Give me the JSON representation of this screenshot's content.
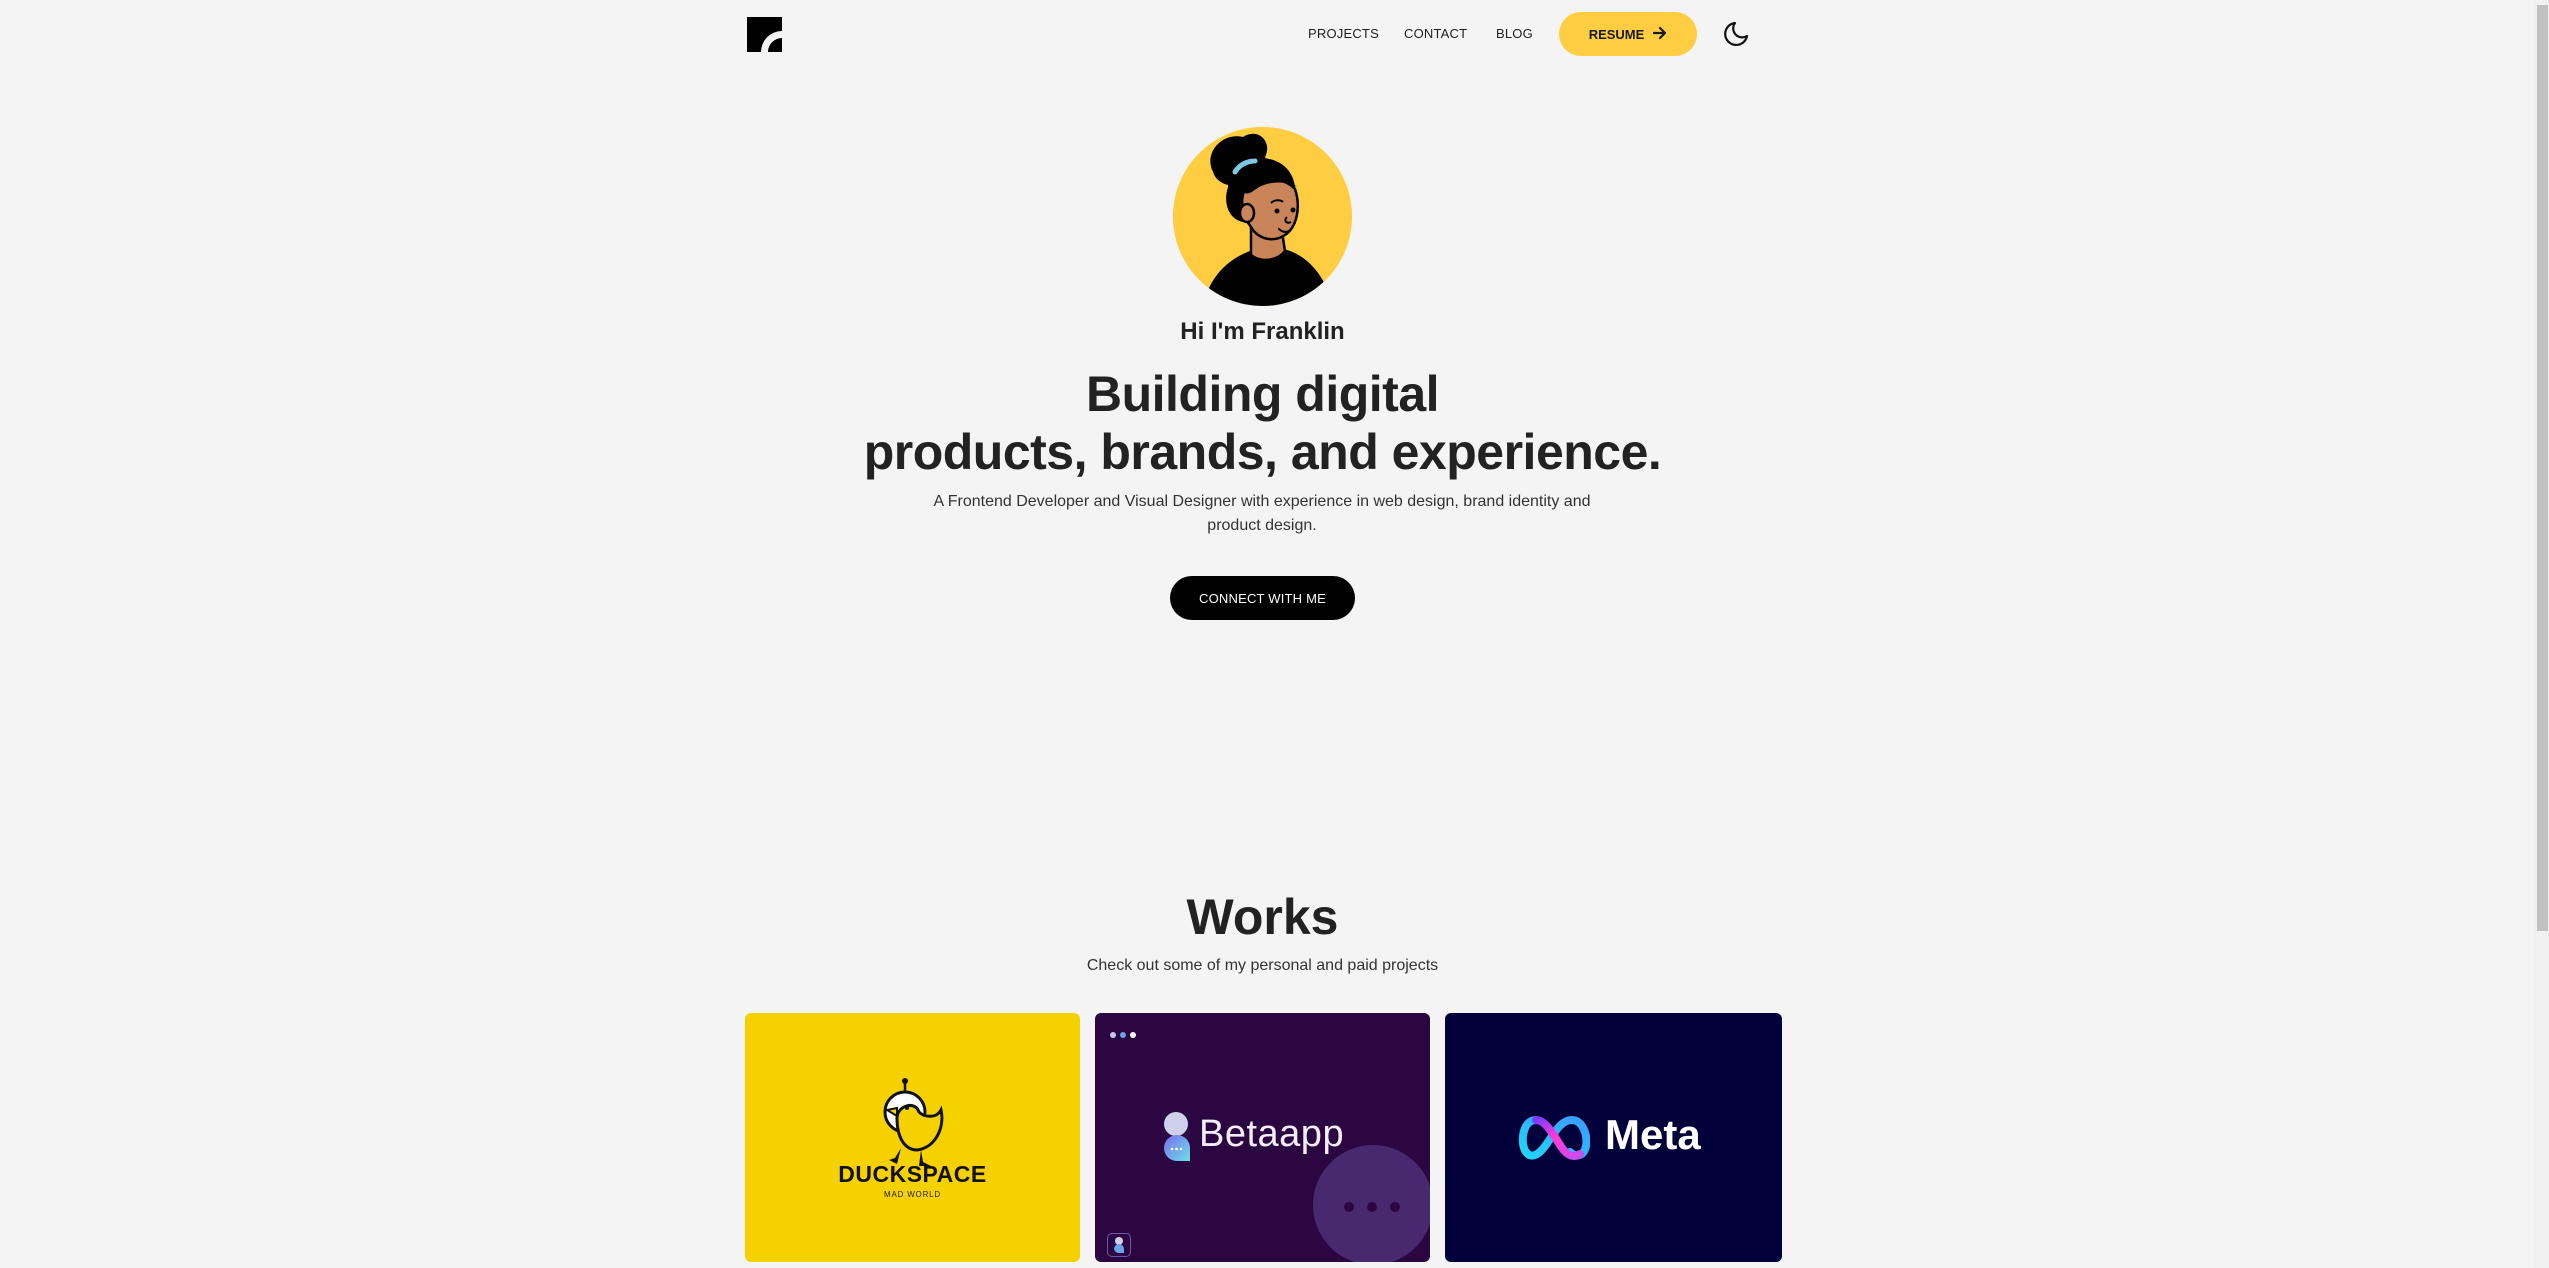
{
  "header": {
    "logo_icon": "brand-logo-icon",
    "nav": [
      {
        "label": "PROJECTS"
      },
      {
        "label": "CONTACT"
      },
      {
        "label": "BLOG"
      }
    ],
    "resume_label": "RESUME",
    "resume_icon": "arrow-right-icon",
    "theme_icon": "moon-icon"
  },
  "hero": {
    "avatar_icon": "avatar-illustration",
    "greeting": "Hi I'm Franklin",
    "headline_line1": "Building digital",
    "headline_line2": "products, brands, and experience.",
    "subtitle": "A Frontend Developer and Visual Designer with experience in web design, brand identity and product design.",
    "cta_label": "CONNECT WITH ME"
  },
  "works": {
    "title": "Works",
    "subtitle": "Check out some of my personal and paid projects",
    "projects": [
      {
        "name": "DUCKSPACE",
        "tagline": "MAD WORLD",
        "bg": "#f6d100"
      },
      {
        "name": "Betaapp",
        "bg": "#2b0640"
      },
      {
        "name": "Meta",
        "bg": "#02003a"
      }
    ]
  },
  "colors": {
    "accent": "#ffcd42",
    "background": "#f4f4f4",
    "text": "#222222"
  }
}
